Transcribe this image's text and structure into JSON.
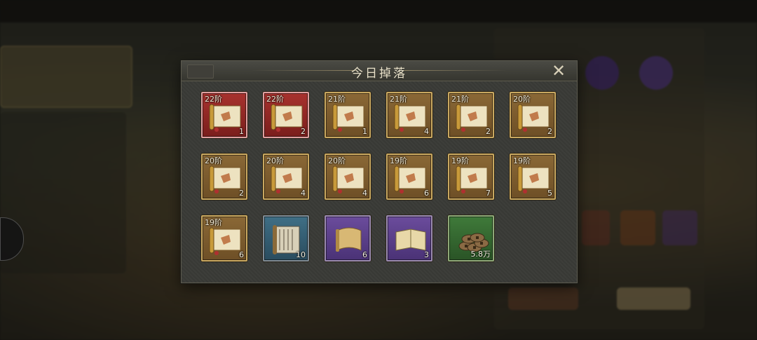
{
  "modal": {
    "title": "今日掉落",
    "close_icon": "close-icon"
  },
  "colors": {
    "gold_frame": "#c9a860",
    "red_frame": "#a8322e",
    "blue_frame": "#3f6f86",
    "purple_frame": "#6b4c9c",
    "green_frame": "#3f7a3a"
  },
  "items": [
    {
      "tier": "22阶",
      "count": "1",
      "rarity": "red",
      "icon": "blueprint-scroll-icon"
    },
    {
      "tier": "22阶",
      "count": "2",
      "rarity": "red",
      "icon": "blueprint-scroll-icon"
    },
    {
      "tier": "21阶",
      "count": "1",
      "rarity": "gold",
      "icon": "blueprint-scroll-icon"
    },
    {
      "tier": "21阶",
      "count": "4",
      "rarity": "gold",
      "icon": "blueprint-scroll-icon"
    },
    {
      "tier": "21阶",
      "count": "2",
      "rarity": "gold",
      "icon": "blueprint-scroll-icon"
    },
    {
      "tier": "20阶",
      "count": "2",
      "rarity": "gold",
      "icon": "blueprint-scroll-icon"
    },
    {
      "tier": "20阶",
      "count": "2",
      "rarity": "gold",
      "icon": "blueprint-scroll-icon"
    },
    {
      "tier": "20阶",
      "count": "4",
      "rarity": "gold",
      "icon": "blueprint-scroll-icon"
    },
    {
      "tier": "20阶",
      "count": "4",
      "rarity": "gold",
      "icon": "blueprint-scroll-icon"
    },
    {
      "tier": "19阶",
      "count": "6",
      "rarity": "gold",
      "icon": "blueprint-scroll-icon"
    },
    {
      "tier": "19阶",
      "count": "7",
      "rarity": "gold",
      "icon": "blueprint-scroll-icon"
    },
    {
      "tier": "19阶",
      "count": "5",
      "rarity": "gold",
      "icon": "blueprint-scroll-icon"
    },
    {
      "tier": "19阶",
      "count": "6",
      "rarity": "gold",
      "icon": "blueprint-scroll-icon"
    },
    {
      "tier": "",
      "count": "10",
      "rarity": "blue",
      "icon": "bamboo-scroll-icon"
    },
    {
      "tier": "",
      "count": "6",
      "rarity": "purple",
      "icon": "paper-scroll-icon"
    },
    {
      "tier": "",
      "count": "3",
      "rarity": "purple",
      "icon": "book-icon"
    },
    {
      "tier": "",
      "count": "5.8万",
      "rarity": "green",
      "icon": "coins-icon"
    }
  ]
}
